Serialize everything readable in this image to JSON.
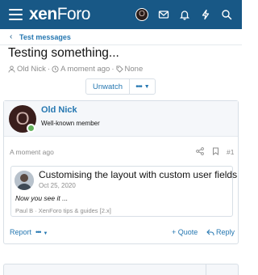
{
  "header": {
    "logo_main": "xen",
    "logo_rest": "Foro",
    "avatar_letter": "O",
    "icons": [
      "menu-icon",
      "envelope-icon",
      "bell-icon",
      "bolt-icon",
      "search-icon"
    ],
    "brand_color": "#185886"
  },
  "breadcrumb": {
    "label": "Test messages"
  },
  "thread": {
    "title": "Testing something...",
    "author": "Old Nick",
    "time": "A moment ago",
    "tags": "None"
  },
  "actions": {
    "unwatch": "Unwatch",
    "more": "•••"
  },
  "post": {
    "username": "Old Nick",
    "user_title": "Well-known member",
    "avatar_letter": "O",
    "time": "A moment ago",
    "number": "#1",
    "embed": {
      "title": "Customising the layout with custom user fields",
      "date": "Oct 25, 2020",
      "body": "Now you see it ...",
      "footer": "Paul B · XenForo tips & guides [2.x]"
    },
    "report": "Report",
    "more": "•••",
    "quote": "+ Quote",
    "reply": "Reply"
  }
}
